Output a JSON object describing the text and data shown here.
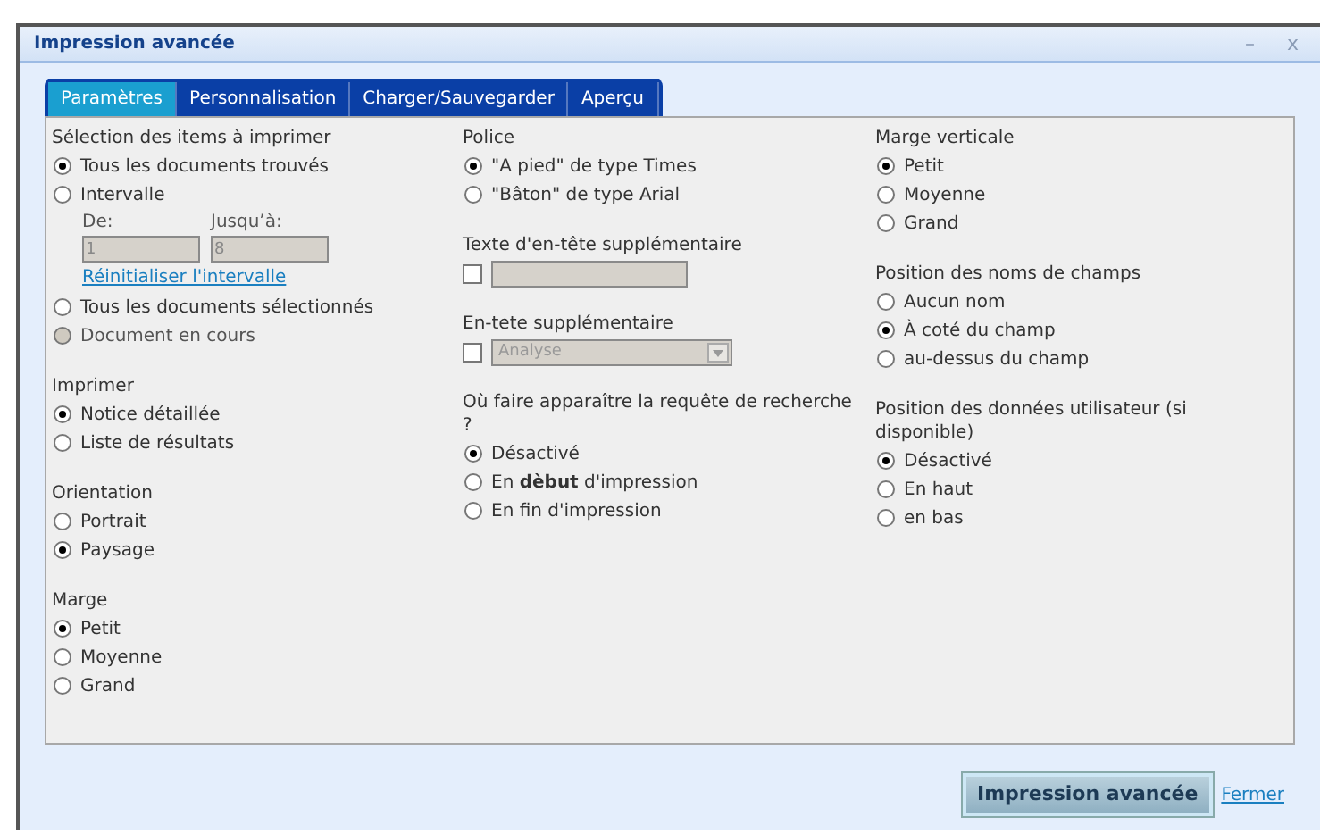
{
  "window": {
    "title": "Impression avancée",
    "controls": [
      "–",
      "x"
    ]
  },
  "tabs": [
    {
      "label": "Paramètres",
      "selected": true
    },
    {
      "label": "Personnalisation",
      "selected": false
    },
    {
      "label": "Charger/Sauvegarder",
      "selected": false
    },
    {
      "label": "Aperçu",
      "selected": false
    }
  ],
  "columns": [
    [
      {
        "title": "Sélection des items à imprimer",
        "items": [
          {
            "kind": "radio",
            "label": "Tous les documents trouvés",
            "selected": true,
            "disabled": false
          },
          {
            "kind": "radio",
            "label": "Intervalle",
            "selected": false,
            "disabled": false
          },
          {
            "kind": "range",
            "from_label": "De:",
            "from_value": "1",
            "to_label": "Jusqu’à:",
            "to_value": "8"
          },
          {
            "kind": "link",
            "label": "Réinitialiser l'intervalle"
          },
          {
            "kind": "radio",
            "label": "Tous les documents sélectionnés",
            "selected": false,
            "disabled": false
          },
          {
            "kind": "radio",
            "label": "Document en cours",
            "selected": false,
            "disabled": true
          }
        ]
      },
      {
        "title": "Imprimer",
        "items": [
          {
            "kind": "radio",
            "label": "Notice détaillée",
            "selected": true,
            "disabled": false
          },
          {
            "kind": "radio",
            "label": "Liste de résultats",
            "selected": false,
            "disabled": false
          }
        ]
      },
      {
        "title": "Orientation",
        "items": [
          {
            "kind": "radio",
            "label": "Portrait",
            "selected": false,
            "disabled": false
          },
          {
            "kind": "radio",
            "label": "Paysage",
            "selected": true,
            "disabled": false
          }
        ]
      },
      {
        "title": "Marge",
        "items": [
          {
            "kind": "radio",
            "label": "Petit",
            "selected": true,
            "disabled": false
          },
          {
            "kind": "radio",
            "label": "Moyenne",
            "selected": false,
            "disabled": false
          },
          {
            "kind": "radio",
            "label": "Grand",
            "selected": false,
            "disabled": false
          }
        ]
      }
    ],
    [
      {
        "title": "Police",
        "items": [
          {
            "kind": "radio",
            "label": "\"A pied\" de type Times",
            "selected": true,
            "disabled": false
          },
          {
            "kind": "radio",
            "label": "\"Bâton\" de type Arial",
            "selected": false,
            "disabled": false
          }
        ]
      },
      {
        "title": "Texte d'en-tête supplémentaire",
        "items": [
          {
            "kind": "checkbox-field",
            "checked": false
          }
        ]
      },
      {
        "title": "En-tete supplémentaire",
        "items": [
          {
            "kind": "checkbox-select",
            "checked": false,
            "value": "Analyse"
          }
        ]
      },
      {
        "title": "Où faire apparaître la requête de recherche ?",
        "items": [
          {
            "kind": "radio",
            "label": "Désactivé",
            "selected": true,
            "disabled": false
          },
          {
            "kind": "radio",
            "label": "En **dèbut** d'impression",
            "selected": false,
            "disabled": false
          },
          {
            "kind": "radio",
            "label": "En fin d'impression",
            "selected": false,
            "disabled": false
          }
        ]
      }
    ],
    [
      {
        "title": "Marge verticale",
        "items": [
          {
            "kind": "radio",
            "label": "Petit",
            "selected": true,
            "disabled": false
          },
          {
            "kind": "radio",
            "label": "Moyenne",
            "selected": false,
            "disabled": false
          },
          {
            "kind": "radio",
            "label": "Grand",
            "selected": false,
            "disabled": false
          }
        ]
      },
      {
        "title": "Position des noms de champs",
        "items": [
          {
            "kind": "radio",
            "label": "Aucun nom",
            "selected": false,
            "disabled": false
          },
          {
            "kind": "radio",
            "label": "À coté du champ",
            "selected": true,
            "disabled": false
          },
          {
            "kind": "radio",
            "label": "au-dessus du champ",
            "selected": false,
            "disabled": false
          }
        ]
      },
      {
        "title": "Position des données utilisateur (si disponible)",
        "items": [
          {
            "kind": "radio",
            "label": "Désactivé",
            "selected": true,
            "disabled": false
          },
          {
            "kind": "radio",
            "label": "En haut",
            "selected": false,
            "disabled": false
          },
          {
            "kind": "radio",
            "label": "en bas",
            "selected": false,
            "disabled": false
          }
        ]
      }
    ]
  ],
  "footer": {
    "button": "Impression avancée",
    "link": "Fermer"
  }
}
